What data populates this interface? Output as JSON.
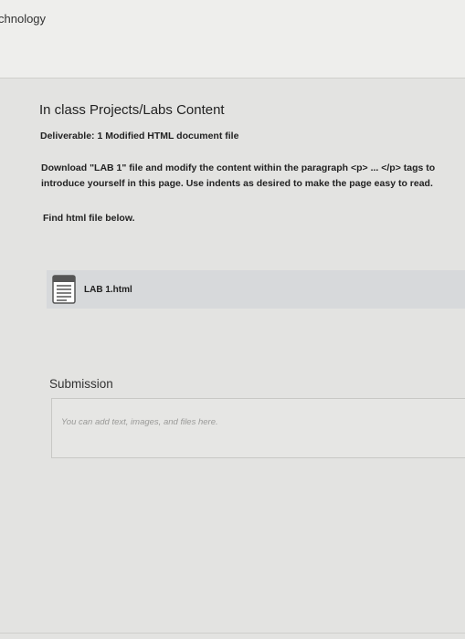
{
  "header": {
    "title": "chnology"
  },
  "main": {
    "section_title": "In class Projects/Labs Content",
    "deliverable": "Deliverable: 1 Modified HTML document file",
    "instructions": "Download \"LAB 1\" file and modify the content within the paragraph <p> ... </p> tags to introduce yourself in this page. Use indents as desired to make the page easy to read.",
    "find_text": "Find html file below.",
    "file": {
      "name": "LAB 1.html",
      "icon": "html-file-icon"
    }
  },
  "submission": {
    "title": "Submission",
    "placeholder": "You can add text, images, and files here."
  }
}
